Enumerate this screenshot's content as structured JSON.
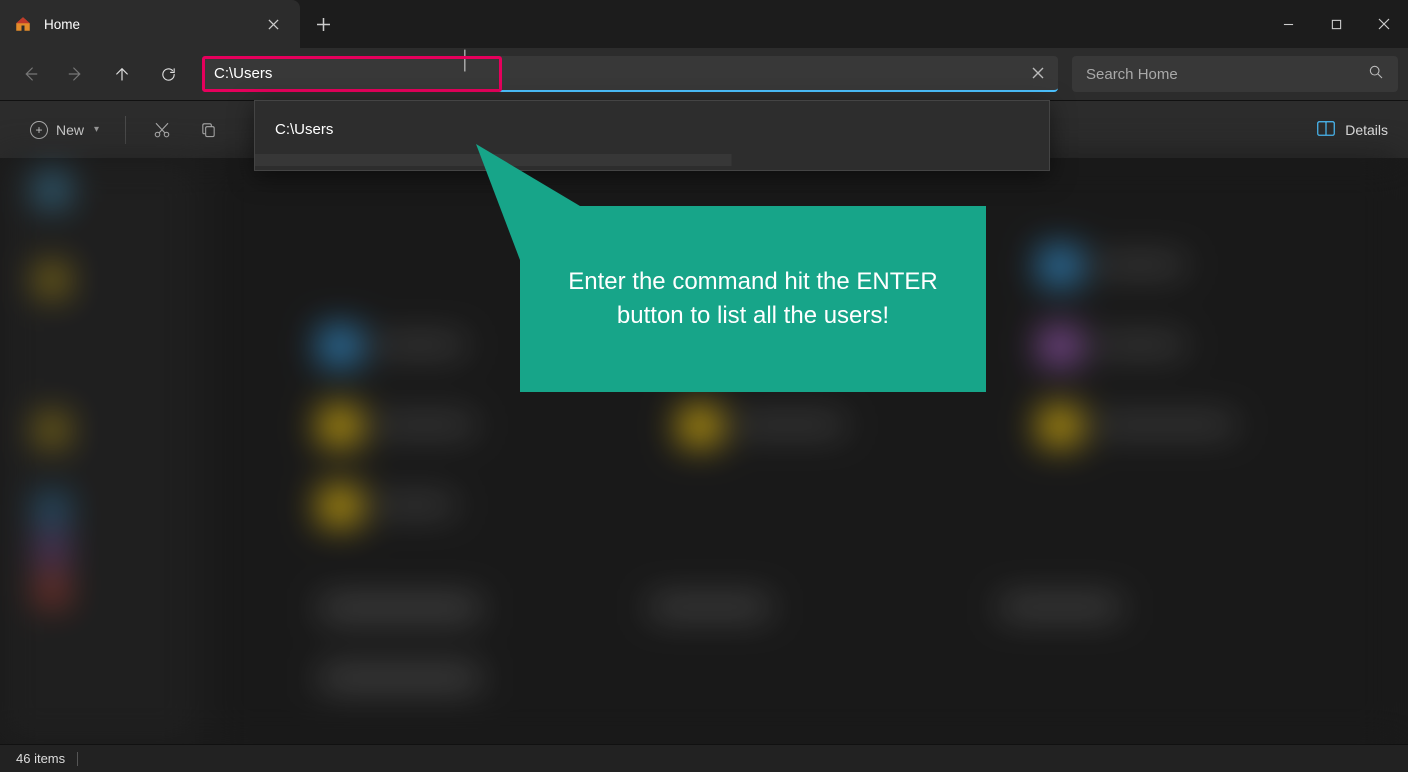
{
  "tab": {
    "title": "Home",
    "icon": "home-icon"
  },
  "nav": {
    "address_value": "C:\\Users",
    "search_placeholder": "Search Home"
  },
  "toolbar": {
    "new_label": "New",
    "details_label": "Details"
  },
  "autocomplete": {
    "items": [
      "C:\\Users"
    ]
  },
  "callout": {
    "text": "Enter the command hit the ENTER button to list all the users!"
  },
  "status": {
    "items_count": "46 items"
  },
  "colors": {
    "accent": "#4cc2ff",
    "highlight": "#e6005c",
    "callout_bg": "#17a589"
  }
}
